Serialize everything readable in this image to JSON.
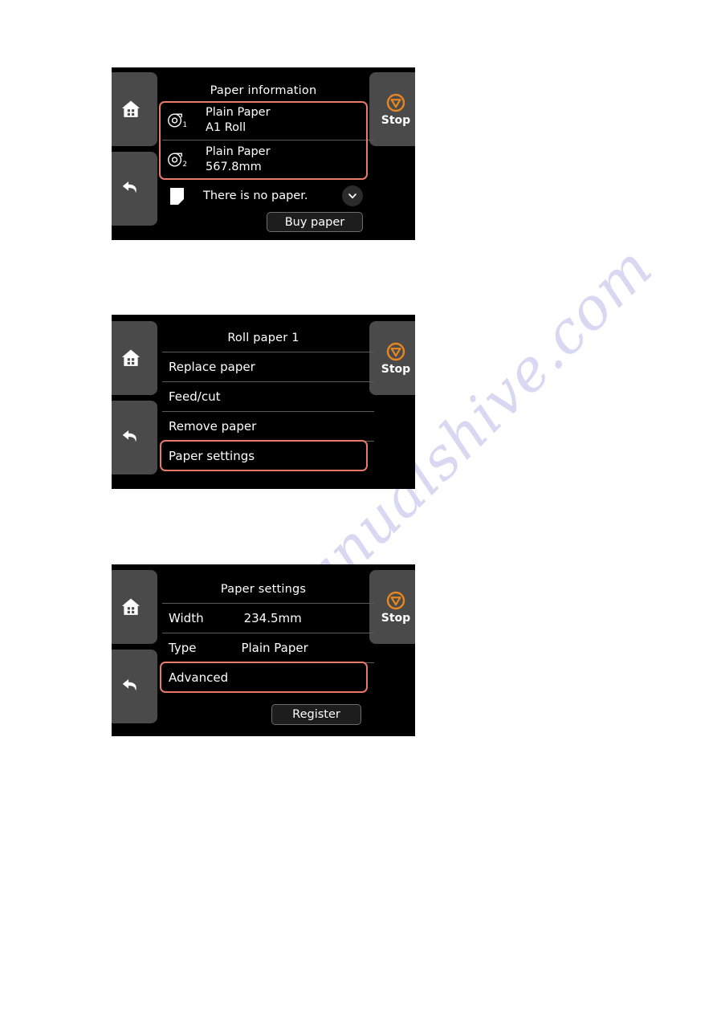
{
  "page": {
    "background_color": "#ffffff",
    "watermark_text": "manualshive.com"
  },
  "colors": {
    "highlight_border": "#e87a68",
    "stop_accent": "#e8861f",
    "screen_background": "#000000",
    "hardkey_background": "#4a4a4a",
    "divider": "#5a5a5a"
  },
  "panels": [
    {
      "id": "paper-information",
      "title": "Paper information",
      "hardkeys": {
        "home": "home-icon",
        "back": "back-icon",
        "stop_label": "Stop",
        "stop_icon": "stop-icon"
      },
      "rolls": [
        {
          "icon": "roll-paper-1-icon",
          "index": "1",
          "type": "Plain Paper",
          "size": "A1 Roll"
        },
        {
          "icon": "roll-paper-2-icon",
          "index": "2",
          "type": "Plain Paper",
          "size": "567.8mm"
        }
      ],
      "sheet_row": {
        "icon": "cut-sheet-icon",
        "status": "There is no paper.",
        "expand_icon": "chevron-down-icon"
      },
      "buy_button": "Buy paper"
    },
    {
      "id": "roll-paper-1-menu",
      "title": "Roll paper 1",
      "hardkeys": {
        "home": "home-icon",
        "back": "back-icon",
        "stop_label": "Stop",
        "stop_icon": "stop-icon"
      },
      "menu_items": [
        "Replace paper",
        "Feed/cut",
        "Remove paper",
        "Paper settings"
      ],
      "highlighted_item": "Paper settings"
    },
    {
      "id": "paper-settings",
      "title": "Paper settings",
      "hardkeys": {
        "home": "home-icon",
        "back": "back-icon",
        "stop_label": "Stop",
        "stop_icon": "stop-icon"
      },
      "settings_rows": [
        {
          "label": "Width",
          "value": "234.5mm"
        },
        {
          "label": "Type",
          "value": "Plain Paper"
        }
      ],
      "advanced_item": "Advanced",
      "register_button": "Register"
    }
  ]
}
